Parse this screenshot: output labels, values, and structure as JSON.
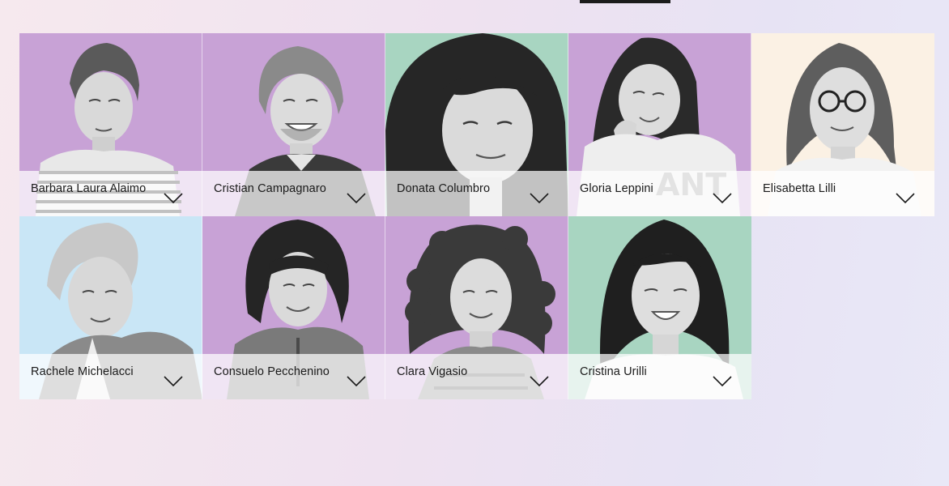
{
  "people": [
    {
      "name": "Barbara Laura Alaimo",
      "bg": "#c8a2d6"
    },
    {
      "name": "Cristian Campagnaro",
      "bg": "#c8a2d6"
    },
    {
      "name": "Donata Columbro",
      "bg": "#a8d5c1"
    },
    {
      "name": "Gloria Leppini",
      "bg": "#c8a2d6"
    },
    {
      "name": "Elisabetta Lilli",
      "bg": "#fbf1e4"
    },
    {
      "name": "Rachele Michelacci",
      "bg": "#c9e6f6"
    },
    {
      "name": "Consuelo Pecchenino",
      "bg": "#c8a2d6"
    },
    {
      "name": "Clara Vigasio",
      "bg": "#c8a2d6"
    },
    {
      "name": "Cristina Urilli",
      "bg": "#a8d5c1"
    }
  ],
  "icons": {
    "expand": "chevron-down-icon",
    "portrait": "portrait-photo"
  }
}
